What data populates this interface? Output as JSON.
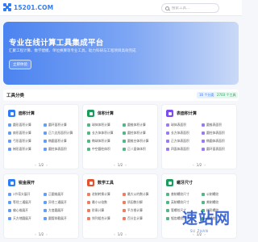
{
  "header": {
    "logo_text": "15201.COM",
    "search_placeholder": "搜索工具..."
  },
  "hero": {
    "title": "专业在线计算工具集成平台",
    "subtitle": "汇聚工程计算、数学建模、单位换算等专业工具，助力科研与工程项目高效完成",
    "button": "立即体验"
  },
  "section": {
    "title": "工具分类",
    "badge_categories": "16 个分类",
    "badge_tools": "2703 个工具"
  },
  "cards": [
    {
      "title": "面积计算",
      "color": "#2f7cf6",
      "tools": [
        "圆形面积计算",
        "圆环面积计算",
        "扇形面积计算",
        "正六边形面积计算",
        "弓形面积计算",
        "椭圆面积计算",
        "梯形面积计算",
        "圆柱体表面积"
      ],
      "pager": "1/2"
    },
    {
      "title": "体积计算",
      "color": "#1a9d5a",
      "tools": [
        "球体体积计算",
        "圆锥体积计算",
        "长方体体积计算",
        "圆柱体积计算",
        "椭球体积计算",
        "圆锥台体积计算",
        "中空圆柱体积",
        "正八面体体积"
      ],
      "pager": "1/2"
    },
    {
      "title": "表面积计算",
      "color": "#7b4cf0",
      "tools": [
        "球体表面积",
        "圆锥表面积",
        "长方体表面积",
        "圆柱体表面积",
        "正方体表面积",
        "椭圆体表面积",
        "四面体表面积",
        "圆环面表面积"
      ],
      "pager": "1/2"
    },
    {
      "title": "锐金展开",
      "color": "#2f7cf6",
      "tools": [
        "2节弯头展开",
        "正圆锥展开",
        "等径三通展开",
        "异径三通展开",
        "偏心锥展开",
        "方变圆展开",
        "天方地圆展开",
        "圆管斜截展开"
      ],
      "pager": "1/2"
    },
    {
      "title": "数学工具",
      "color": "#e4532f",
      "tools": [
        "进制转换计算",
        "最大公约数计算",
        "最小公倍数",
        "质因数分解",
        "阶乘计算",
        "平方根计算",
        "排列组合计算",
        "百分比计算"
      ],
      "pager": "1/2"
    },
    {
      "title": "螺牙尺寸",
      "color": "#1a9d5a",
      "tools": [
        "普制螺纹尺寸",
        "公制螺纹",
        "英制螺纹尺寸",
        "美制螺纹",
        "管螺纹尺寸",
        "梯形螺纹",
        "锯齿螺纹尺寸",
        "圆螺纹"
      ],
      "pager": "1/2"
    }
  ],
  "watermark": {
    "text": "速站网",
    "sub": "SU ZHAN"
  }
}
